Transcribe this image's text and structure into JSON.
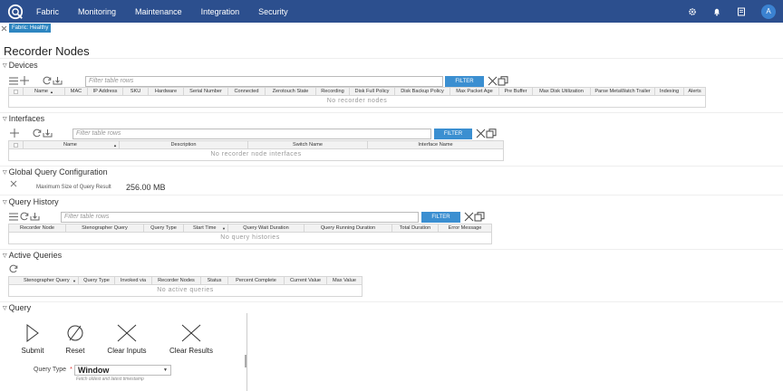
{
  "nav": {
    "items": [
      "Fabric",
      "Monitoring",
      "Maintenance",
      "Integration",
      "Security"
    ],
    "avatar": "A"
  },
  "status": {
    "badge": "Fabric: Healthy"
  },
  "page": {
    "title": "Recorder Nodes"
  },
  "devices": {
    "title": "Devices",
    "filter_placeholder": "Filter table rows",
    "filter_label": "FILTER",
    "columns": [
      "Name",
      "MAC",
      "IP Address",
      "SKU",
      "Hardware",
      "Serial Number",
      "Connected",
      "Zerotouch State",
      "Recording",
      "Disk Full Policy",
      "Disk Backup Policy",
      "Max Packet Age",
      "Pre Buffer",
      "Max Disk Utilization",
      "Parse MetaWatch Trailer",
      "Indexing",
      "Alerts"
    ],
    "empty": "No recorder nodes"
  },
  "interfaces": {
    "title": "Interfaces",
    "filter_placeholder": "Filter table rows",
    "filter_label": "FILTER",
    "columns": [
      "Name",
      "Description",
      "Switch Name",
      "Interface Name"
    ],
    "empty": "No recorder node interfaces"
  },
  "global_query": {
    "title": "Global Query Configuration",
    "label": "Maximum Size of Query Result",
    "value": "256.00 MB"
  },
  "query_history": {
    "title": "Query History",
    "filter_placeholder": "Filter table rows",
    "filter_label": "FILTER",
    "columns": [
      "Recorder Node",
      "Stenographer Query",
      "Query Type",
      "Start Time",
      "Query Wait Duration",
      "Query Running Duration",
      "Total Duration",
      "Error Message"
    ],
    "empty": "No query histories"
  },
  "active_queries": {
    "title": "Active Queries",
    "columns": [
      "Stenographer Query",
      "Query Type",
      "Invoked via",
      "Recorder Nodes",
      "Status",
      "Percent Complete",
      "Current Value",
      "Max Value"
    ],
    "empty": "No active queries"
  },
  "query": {
    "title": "Query",
    "buttons": {
      "submit": "Submit",
      "reset": "Reset",
      "clear_inputs": "Clear Inputs",
      "clear_results": "Clear Results"
    },
    "type_label": "Query Type",
    "type_value": "Window",
    "type_hint": "Fetch oldest and latest timestamp"
  },
  "colors": {
    "topbar": "#2c4f8e",
    "accent": "#3b8fd1",
    "badge": "#2e86c1"
  }
}
